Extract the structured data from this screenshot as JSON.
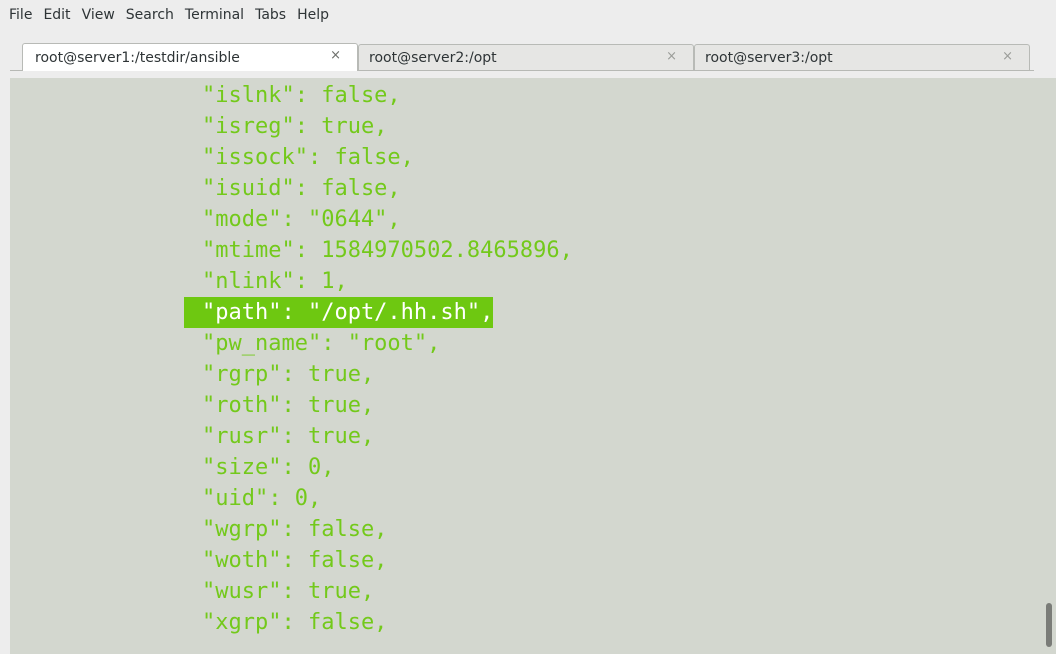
{
  "menubar": {
    "items": [
      "File",
      "Edit",
      "View",
      "Search",
      "Terminal",
      "Tabs",
      "Help"
    ]
  },
  "tabs": [
    {
      "label": "root@server1:/testdir/ansible",
      "close": "×",
      "active": true
    },
    {
      "label": "root@server2:/opt",
      "close": "×",
      "active": false
    },
    {
      "label": "root@server3:/opt",
      "close": "×",
      "active": false
    }
  ],
  "terminal": {
    "indent": "           ",
    "lines": [
      "\"islnk\": false,",
      "\"isreg\": true,",
      "\"issock\": false,",
      "\"isuid\": false,",
      "\"mode\": \"0644\",",
      "\"mtime\": 1584970502.8465896,",
      "\"nlink\": 1,",
      "\"path\": \"/opt/.hh.sh\",",
      "\"pw_name\": \"root\",",
      "\"rgrp\": true,",
      "\"roth\": true,",
      "\"rusr\": true,",
      "\"size\": 0,",
      "\"uid\": 0,",
      "\"wgrp\": false,",
      "\"woth\": false,",
      "\"wusr\": true,",
      "\"xgrp\": false,"
    ],
    "highlighted_line": "\"path\": \"/opt/.hh.sh\",",
    "colors": {
      "background": "#d3d7cf",
      "text": "#73c91b",
      "selection": "#6ec811",
      "selection_text": "#ffffff"
    }
  }
}
